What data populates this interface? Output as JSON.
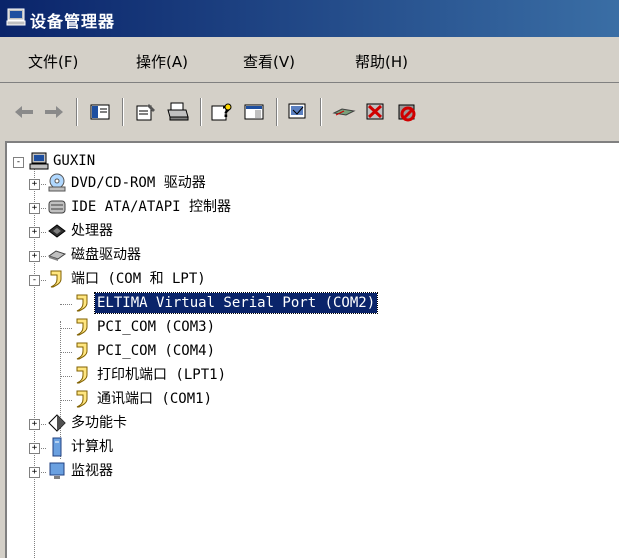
{
  "window": {
    "title": "设备管理器"
  },
  "menu": {
    "file": "文件(F)",
    "action": "操作(A)",
    "view": "查看(V)",
    "help": "帮助(H)"
  },
  "toolbar": {
    "icons": [
      "back-arrow-icon",
      "forward-arrow-icon",
      "show-hide-tree-icon",
      "properties-icon",
      "print-icon",
      "help-icon",
      "console-icon",
      "scan-hardware-icon",
      "update-driver-icon",
      "uninstall-icon",
      "disable-icon"
    ]
  },
  "tree": {
    "root": "GUXIN",
    "items": [
      {
        "label": "DVD/CD-ROM 驱动器",
        "expander": "+"
      },
      {
        "label": "IDE ATA/ATAPI 控制器",
        "expander": "+"
      },
      {
        "label": "处理器",
        "expander": "+"
      },
      {
        "label": "磁盘驱动器",
        "expander": "+"
      },
      {
        "label": "端口 (COM 和 LPT)",
        "expander": "-"
      },
      {
        "label": "多功能卡",
        "expander": "+"
      },
      {
        "label": "计算机",
        "expander": "+"
      },
      {
        "label": "监视器",
        "expander": "+"
      }
    ],
    "ports": [
      "ELTIMA Virtual Serial Port (COM2)",
      "PCI_COM (COM3)",
      "PCI_COM (COM4)",
      "打印机端口 (LPT1)",
      "通讯端口 (COM1)"
    ],
    "root_expander": "-"
  },
  "colors": {
    "titlebar": "#0a246a",
    "selection": "#0a246a",
    "face": "#d4d0c8"
  }
}
